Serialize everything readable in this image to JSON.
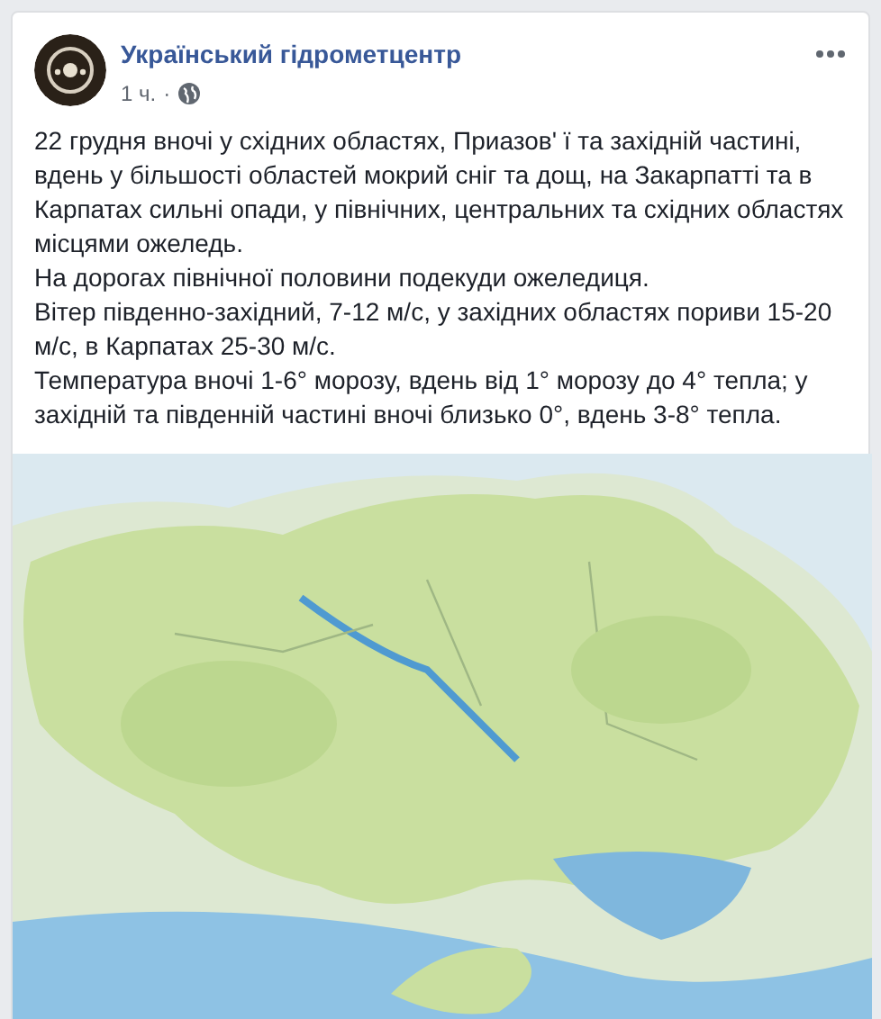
{
  "post": {
    "author": "Український гідрометцентр",
    "time": "1 ч.",
    "separator": "·",
    "paragraphs": [
      "22 грудня вночі у східних областях, Приазов' ї та західній частині, вдень у більшості областей мокрий сніг та дощ, на Закарпатті та в Карпатах сильні опади, у північних, центральних та східних областях місцями ожеледь.",
      "На дорогах північної половини подекуди ожеледиця.",
      "Вітер південно-західний, 7-12 м/с, у західних областях пориви 15-20 м/с, в Карпатах 25-30 м/с.",
      "Температура вночі 1-6° морозу, вдень від 1° морозу до 4° тепла; у західній та південній частині вночі близько 0°, вдень 3-8° тепла."
    ]
  }
}
